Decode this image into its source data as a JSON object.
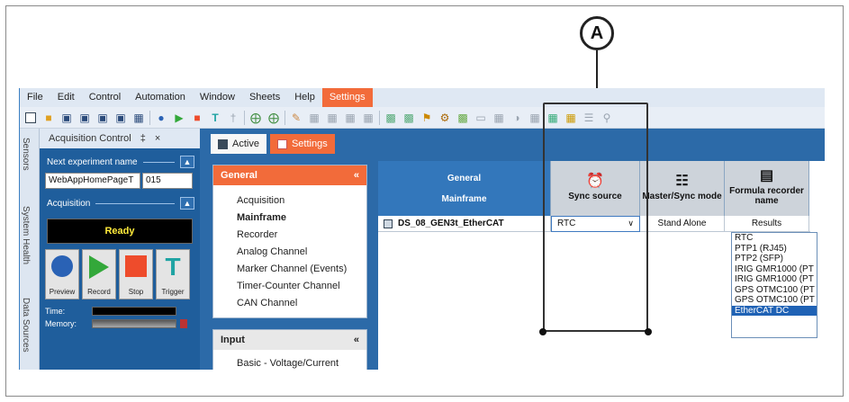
{
  "callout": {
    "label": "A"
  },
  "menu": [
    "File",
    "Edit",
    "Control",
    "Automation",
    "Window",
    "Sheets",
    "Help",
    "Settings"
  ],
  "menu_active": "Settings",
  "dock_tabs": [
    "Sensors",
    "System Health",
    "Data Sources"
  ],
  "acquisition_panel": {
    "title": "Acquisition Control",
    "pin_glyph": "‡",
    "close_glyph": "×",
    "next_experiment_label": "Next experiment name",
    "experiment_name": "WebAppHomePageT",
    "experiment_number": "015",
    "acquisition_label": "Acquisition",
    "status": "Ready",
    "buttons": [
      "Preview",
      "Record",
      "Stop",
      "Trigger"
    ],
    "meters": [
      "Time:",
      "Memory:"
    ]
  },
  "doc_tabs": [
    "Active",
    "Settings"
  ],
  "nav": {
    "general_header": "General",
    "items": [
      "Acquisition",
      "Mainframe",
      "Recorder",
      "Analog Channel",
      "Marker Channel (Events)",
      "Timer-Counter Channel",
      "CAN Channel"
    ],
    "bold_item": "Mainframe",
    "input_header": "Input",
    "input_items": [
      "Basic - Voltage/Current"
    ],
    "collapse_glyph": "«"
  },
  "grid": {
    "headers": {
      "general": "General",
      "mainframe": "Mainframe",
      "sync_source": "Sync source",
      "master_sync_mode": "Master/Sync mode",
      "formula_recorder": "Formula recorder name"
    },
    "row": {
      "name": "DS_08_GEN3t_EtherCAT",
      "sync_value": "RTC",
      "mode": "Stand Alone",
      "recorder": "Results"
    }
  },
  "dropdown_options": [
    "RTC",
    "PTP1 (RJ45)",
    "PTP2 (SFP)",
    "IRIG GMR1000 (PT",
    "IRIG GMR1000 (PT",
    "GPS OTMC100 (PT",
    "GPS OTMC100 (PT",
    "EtherCAT DC"
  ],
  "dropdown_selected": "EtherCAT DC",
  "colors": {
    "accent": "#f26b3a",
    "panel_blue": "#2c6aa8",
    "header_blue": "#3377bb"
  }
}
